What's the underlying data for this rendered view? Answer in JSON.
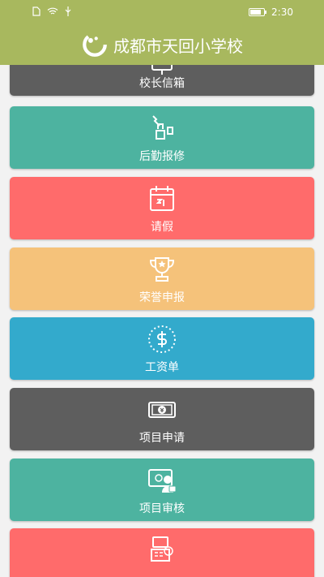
{
  "status_bar": {
    "time": "2:30"
  },
  "header": {
    "title": "成都市天回小学校"
  },
  "colors": {
    "header": "#a8b85e",
    "dark": "#5e5e5e",
    "teal": "#4db3a0",
    "coral": "#ff6b6b",
    "orange": "#f5c27a",
    "blue": "#33aacc"
  },
  "menu": [
    {
      "label": "校长信箱",
      "icon": "mailbox-icon",
      "color": "#5e5e5e"
    },
    {
      "label": "后勤报修",
      "icon": "repair-tools-icon",
      "color": "#4db3a0"
    },
    {
      "label": "请假",
      "icon": "calendar-icon",
      "color": "#ff6b6b"
    },
    {
      "label": "荣誉申报",
      "icon": "trophy-icon",
      "color": "#f5c27a"
    },
    {
      "label": "工资单",
      "icon": "dollar-coin-icon",
      "color": "#33aacc"
    },
    {
      "label": "项目申请",
      "icon": "yen-banknote-icon",
      "color": "#5e5e5e"
    },
    {
      "label": "项目审核",
      "icon": "review-lock-icon",
      "color": "#4db3a0"
    },
    {
      "label": "",
      "icon": "cashier-icon",
      "color": "#ff6b6b"
    }
  ]
}
